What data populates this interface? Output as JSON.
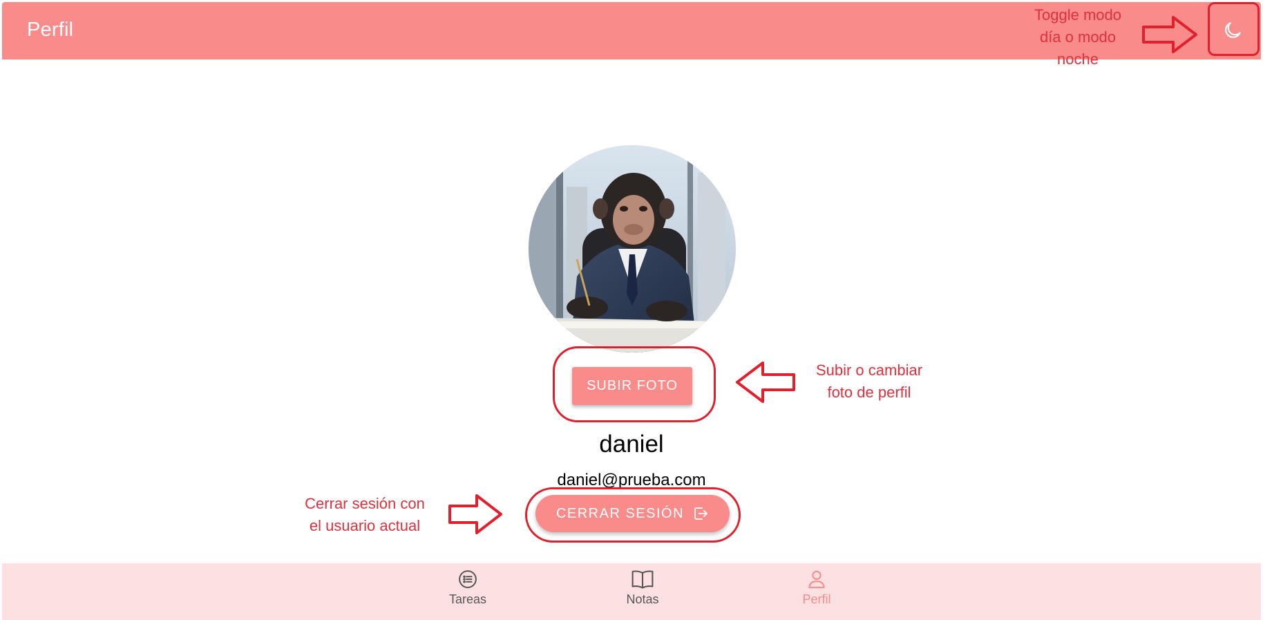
{
  "header": {
    "title": "Perfil"
  },
  "profile": {
    "upload_label": "SUBIR FOTO",
    "name": "daniel",
    "email": "daniel@prueba.com",
    "logout_label": "CERRAR SESIÓN"
  },
  "nav": {
    "items": [
      {
        "label": "Tareas",
        "icon": "list-icon",
        "active": false
      },
      {
        "label": "Notas",
        "icon": "book-icon",
        "active": false
      },
      {
        "label": "Perfil",
        "icon": "person-icon",
        "active": true
      }
    ]
  },
  "annotations": {
    "toggle_line1": "Toggle modo",
    "toggle_line2": "día o modo",
    "toggle_line3": "noche",
    "photo_line1": "Subir o cambiar",
    "photo_line2": "foto de perfil",
    "logout_line1": "Cerrar sesión con",
    "logout_line2": "el usuario actual"
  },
  "colors": {
    "primary": "#f98b8b",
    "nav_background": "#fde0e1",
    "annotation": "#e0202c"
  }
}
